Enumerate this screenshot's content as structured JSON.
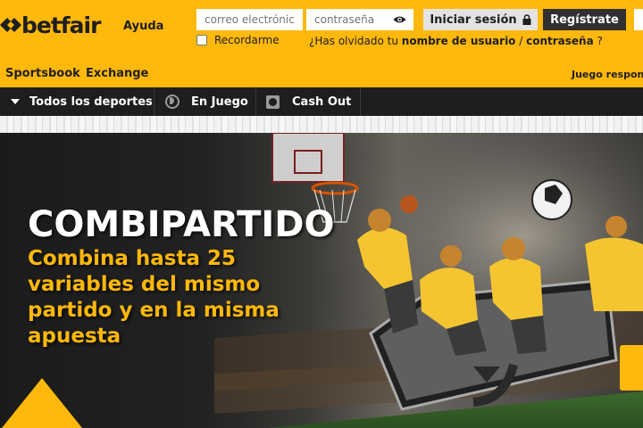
{
  "header": {
    "logo_text": "betfair",
    "help_label": "Ayuda",
    "email_placeholder": "correo electrónic",
    "password_placeholder": "contraseña",
    "login_label": "Iniciar sesión",
    "register_label": "Regístrate",
    "remember_label": "Recordarme",
    "forgot_prefix": "¿Has olvidado tu ",
    "forgot_username": "nombre de usuario",
    "forgot_sep": " / ",
    "forgot_password": "contraseña",
    "forgot_suffix": " ?",
    "tabs": [
      {
        "label": "Sportsbook"
      },
      {
        "label": "Exchange"
      }
    ],
    "responsible_label": "Juego respon",
    "colors": {
      "brand": "#ffb80c",
      "dark": "#1e1e1e"
    }
  },
  "nav": {
    "items": [
      {
        "label": "Todos los deportes",
        "icon": "chevron-down-icon"
      },
      {
        "label": "En Juego",
        "icon": "live-icon"
      },
      {
        "label": "Cash Out",
        "icon": "cash-out-icon"
      }
    ]
  },
  "hero": {
    "title": "COMBIPARTIDO",
    "subtitle": "Combina hasta 25 variables del mismo partido y en la misma apuesta"
  }
}
